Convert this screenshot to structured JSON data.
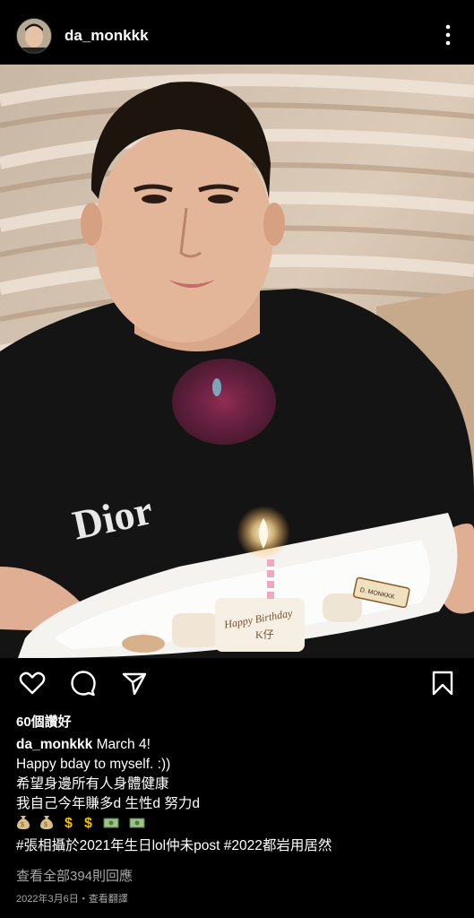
{
  "post": {
    "username": "da_monkkk",
    "likes_text": "60個讚好",
    "caption_date": "March 4!",
    "caption_lines": [
      "Happy bday to myself. :))",
      "希望身邊所有人身體健康",
      "我自己今年賺多d 生性d 努力d",
      "#張相攝於2021年生日lol仲未post #2022都岩用居然"
    ],
    "emoji_line": [
      "money-bag",
      "money-bag",
      "dollar",
      "dollar",
      "banknote",
      "banknote"
    ],
    "view_comments": "查看全部394則回應",
    "date_text": "2022年3月6日・查看翻譯"
  },
  "photo": {
    "cake_text_line1": "Happy Birthday",
    "cake_text_line2": "K仔",
    "shirt_text": "Dior",
    "plate_chocolate": "D. MONKKK"
  },
  "icons": {
    "like": "heart-icon",
    "comment": "comment-icon",
    "share": "share-icon",
    "save": "bookmark-icon",
    "more": "more-vertical-icon"
  }
}
